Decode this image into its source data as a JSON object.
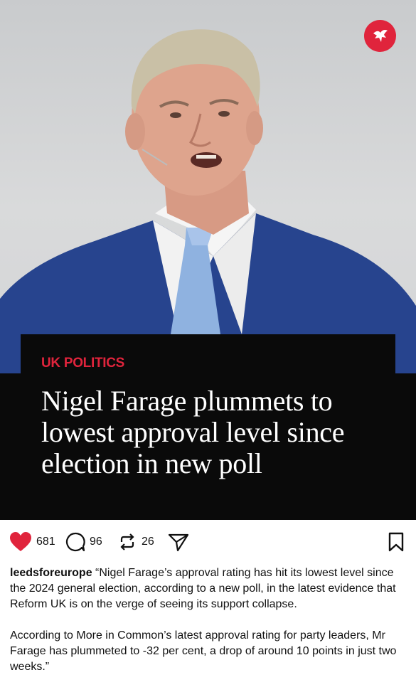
{
  "post": {
    "section_tag": "UK POLITICS",
    "headline": "Nigel Farage plummets to lowest approval level since election in new poll",
    "publisher_logo_icon": "eagle-icon"
  },
  "actions": {
    "likes": "681",
    "comments": "96",
    "reposts": "26"
  },
  "caption": {
    "username": "leedsforeurope",
    "paragraph1": "“Nigel Farage’s approval rating has hit its lowest level since the 2024 general election, according to a new poll, in the latest evidence that Reform UK is on the verge of seeing its support collapse.",
    "paragraph2": "According to More in Common’s latest approval rating for party leaders, Mr Farage has plummeted to -32 per cent, a drop of around 10 points in just two weeks.”"
  },
  "colors": {
    "accent": "#e0243c",
    "heart": "#e0243c",
    "panel": "#0a0a0a"
  }
}
